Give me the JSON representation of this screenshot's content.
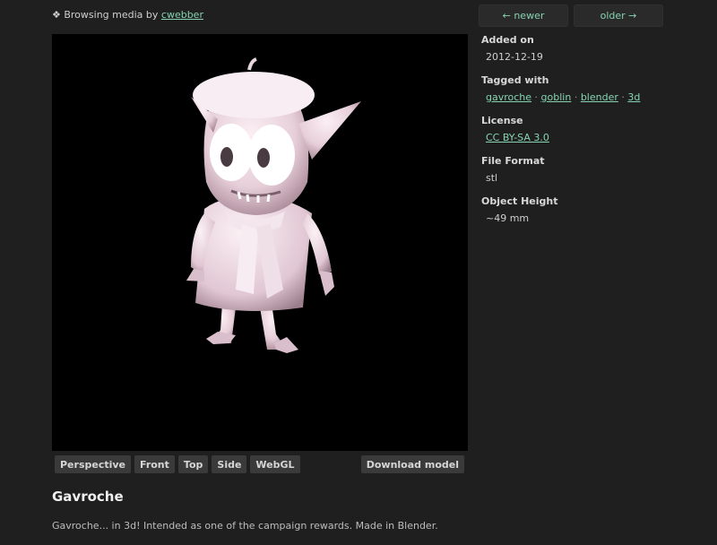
{
  "header": {
    "browsing_prefix": "❖ Browsing media by",
    "user": "cwebber"
  },
  "nav": {
    "newer": "← newer",
    "older": "older →"
  },
  "viewer": {
    "views": [
      "Perspective",
      "Front",
      "Top",
      "Side",
      "WebGL"
    ],
    "download": "Download model"
  },
  "media": {
    "title": "Gavroche",
    "description": "Gavroche... in 3d! Intended as one of the campaign rewards. Made in Blender."
  },
  "meta": {
    "added_label": "Added on",
    "added_value": "2012-12-19",
    "tags_label": "Tagged with",
    "tags": [
      "gavroche",
      "goblin",
      "blender",
      "3d"
    ],
    "tag_separator": "·",
    "license_label": "License",
    "license_value": "CC BY-SA 3.0",
    "format_label": "File Format",
    "format_value": "stl",
    "height_label": "Object Height",
    "height_value": "~49 mm"
  }
}
